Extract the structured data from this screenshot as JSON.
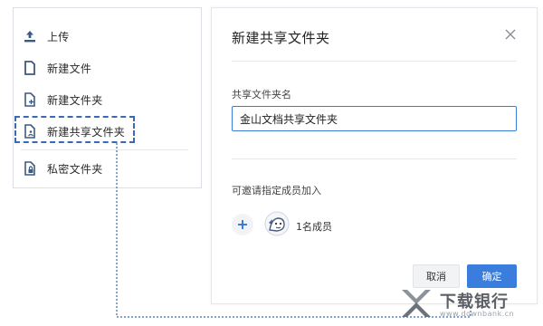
{
  "menu": {
    "items": [
      {
        "label": "上传",
        "icon": "upload-icon"
      },
      {
        "label": "新建文件",
        "icon": "file-icon"
      },
      {
        "label": "新建文件夹",
        "icon": "new-folder-icon"
      },
      {
        "label": "新建共享文件夹",
        "icon": "shared-folder-icon"
      },
      {
        "label": "私密文件夹",
        "icon": "private-folder-icon"
      }
    ]
  },
  "dialog": {
    "title": "新建共享文件夹",
    "close_icon": "close-icon",
    "name_label": "共享文件夹名",
    "name_value": "金山文档共享文件夹",
    "invite_label": "可邀请指定成员加入",
    "add_icon": "plus-icon",
    "member_avatar_icon": "avatar-icon",
    "member_count": "1名成员",
    "cancel_label": "取消",
    "ok_label": "确定"
  },
  "watermark": {
    "text": "下载银行",
    "sub": "www.downbank.cn"
  },
  "colors": {
    "accent": "#3b7ddd",
    "icon": "#3d5a80",
    "highlight": "#3a6ab5"
  }
}
